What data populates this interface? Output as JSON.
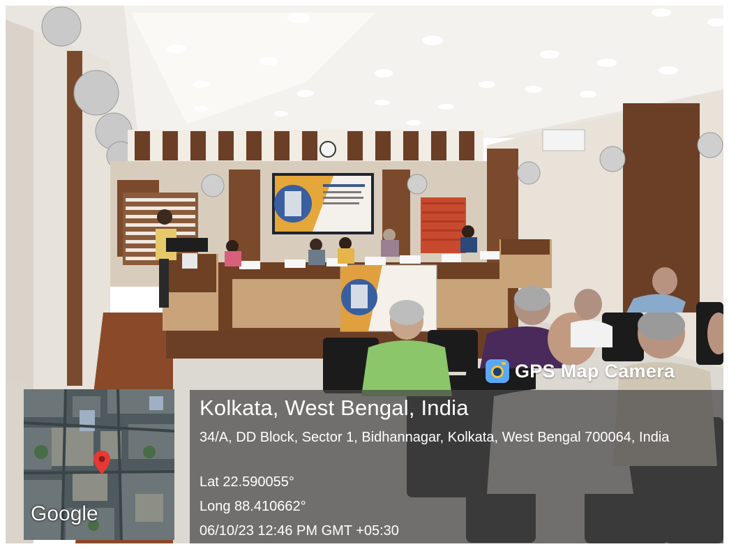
{
  "overlay": {
    "city": "Kolkata, West Bengal, India",
    "address": "34/A, DD Block, Sector 1, Bidhannagar, Kolkata, West Bengal 700064, India",
    "latitude": "Lat 22.590055°",
    "longitude": "Long 88.410662°",
    "datetime": "06/10/23 12:46 PM GMT +05:30"
  },
  "badge": {
    "label": "GPS Map Camera",
    "icon": "camera-icon"
  },
  "map": {
    "logo": "Google",
    "pin_icon": "map-pin-icon",
    "pin_color": "#e53935"
  },
  "colors": {
    "overlay_bg": "#464646",
    "badge_accent": "#5aa7f5",
    "wood": "#6b3f26"
  }
}
